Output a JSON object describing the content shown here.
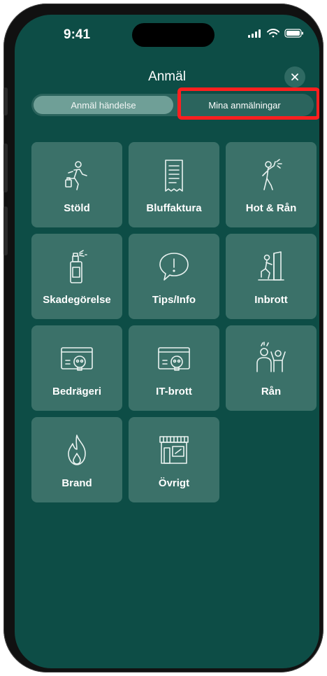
{
  "status": {
    "time": "9:41"
  },
  "header": {
    "title": "Anmäl",
    "close_icon": "×"
  },
  "tabs": {
    "active": "Anmäl händelse",
    "inactive": "Mina anmälningar"
  },
  "categories": [
    {
      "label": "Stöld",
      "icon": "thief-running-icon"
    },
    {
      "label": "Bluffaktura",
      "icon": "receipt-icon"
    },
    {
      "label": "Hot & Rån",
      "icon": "threat-icon"
    },
    {
      "label": "Skadegörelse",
      "icon": "spray-can-icon"
    },
    {
      "label": "Tips/Info",
      "icon": "speech-bubble-exclamation-icon"
    },
    {
      "label": "Inbrott",
      "icon": "break-in-door-icon"
    },
    {
      "label": "Bedrägeri",
      "icon": "card-skull-icon"
    },
    {
      "label": "IT-brott",
      "icon": "card-skull-icon"
    },
    {
      "label": "Rån",
      "icon": "robbery-icon"
    },
    {
      "label": "Brand",
      "icon": "flame-icon"
    },
    {
      "label": "Övrigt",
      "icon": "storefront-icon"
    }
  ],
  "colors": {
    "background": "#0d4d46",
    "card": "#3b7169",
    "highlight": "#ff1f1f"
  }
}
